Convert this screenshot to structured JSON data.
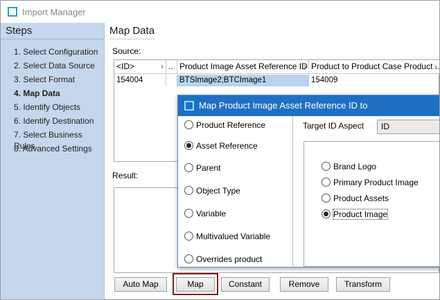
{
  "window": {
    "title": "Import Manager",
    "icon": "window-icon"
  },
  "sidebar": {
    "heading": "Steps",
    "steps": [
      {
        "label": "1. Select Configuration"
      },
      {
        "label": "2. Select Data Source"
      },
      {
        "label": "3. Select Format"
      },
      {
        "label": "4. Map Data",
        "active": true
      },
      {
        "label": "5. Identify Objects"
      },
      {
        "label": "6. Identify Destination"
      },
      {
        "label": "7. Select Business Rules"
      },
      {
        "label": "8. Advanced Settings"
      }
    ]
  },
  "main": {
    "title": "Map Data",
    "source_label": "Source:",
    "result_label": "Result:",
    "table": {
      "columns": [
        "<ID>",
        "..",
        "Product Image Asset Reference ID",
        "Product to Product Case Product ..."
      ],
      "column_chevron": "›",
      "rows": [
        [
          "154004",
          "",
          "BTSImage2;BTCImage1",
          "154009"
        ]
      ]
    },
    "buttons": {
      "auto_map": "Auto Map",
      "map": "Map",
      "constant": "Constant",
      "remove": "Remove",
      "transform": "Transform"
    }
  },
  "dialog": {
    "title": "Map Product Image Asset Reference ID to",
    "options": [
      {
        "label": "Product Reference",
        "checked": false
      },
      {
        "label": "Asset Reference",
        "checked": true
      },
      {
        "label": "Parent",
        "checked": false
      },
      {
        "label": "Object Type",
        "checked": false
      },
      {
        "label": "Variable",
        "checked": false
      },
      {
        "label": "Multivalued Variable",
        "checked": false
      },
      {
        "label": "Overrides product",
        "checked": false
      }
    ],
    "target_id_aspect_label": "Target ID Aspect",
    "target_id_aspect_value": "ID",
    "aspect_options": [
      {
        "label": "Brand Logo",
        "checked": false
      },
      {
        "label": "Primary Product Image",
        "checked": false
      },
      {
        "label": "Product Assets",
        "checked": false
      },
      {
        "label": "Product Image",
        "checked": true
      }
    ]
  },
  "colors": {
    "sidebar_bg": "#c5d7ec",
    "dialog_title_bg": "#1f6fc5",
    "selected_cell": "#b9d3ee",
    "highlight_border": "#8b1a1a"
  }
}
